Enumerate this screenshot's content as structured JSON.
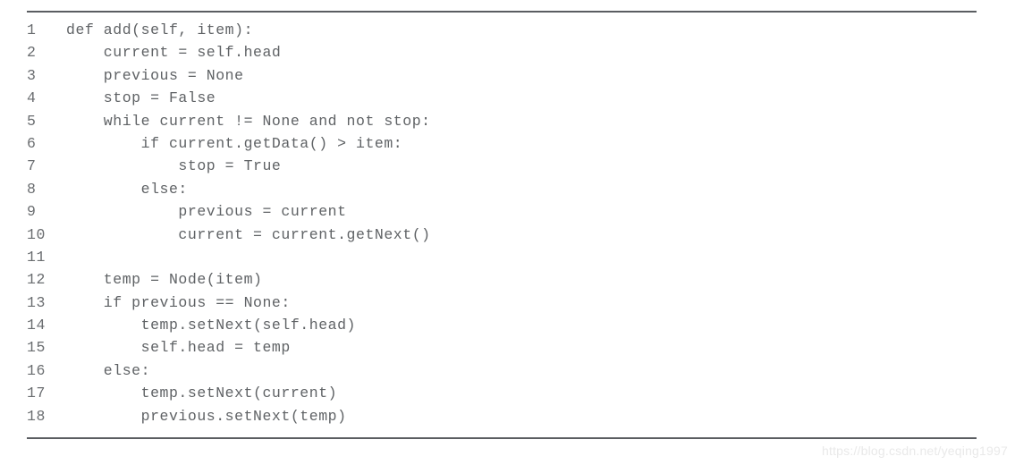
{
  "figure": {
    "language": "python",
    "rule_color": "#5a5d61",
    "text_color": "#5f6265",
    "line_number_color": "#6a6d70",
    "background_color": "#ffffff"
  },
  "code": {
    "lines": [
      {
        "number": "1",
        "text": "def add(self, item):"
      },
      {
        "number": "2",
        "text": "    current = self.head"
      },
      {
        "number": "3",
        "text": "    previous = None"
      },
      {
        "number": "4",
        "text": "    stop = False"
      },
      {
        "number": "5",
        "text": "    while current != None and not stop:"
      },
      {
        "number": "6",
        "text": "        if current.getData() > item:"
      },
      {
        "number": "7",
        "text": "            stop = True"
      },
      {
        "number": "8",
        "text": "        else:"
      },
      {
        "number": "9",
        "text": "            previous = current"
      },
      {
        "number": "10",
        "text": "            current = current.getNext()"
      },
      {
        "number": "11",
        "text": ""
      },
      {
        "number": "12",
        "text": "    temp = Node(item)"
      },
      {
        "number": "13",
        "text": "    if previous == None:"
      },
      {
        "number": "14",
        "text": "        temp.setNext(self.head)"
      },
      {
        "number": "15",
        "text": "        self.head = temp"
      },
      {
        "number": "16",
        "text": "    else:"
      },
      {
        "number": "17",
        "text": "        temp.setNext(current)"
      },
      {
        "number": "18",
        "text": "        previous.setNext(temp)"
      }
    ]
  },
  "watermark": {
    "text": "https://blog.csdn.net/yeqing1997",
    "color": "#e9e9e9"
  }
}
